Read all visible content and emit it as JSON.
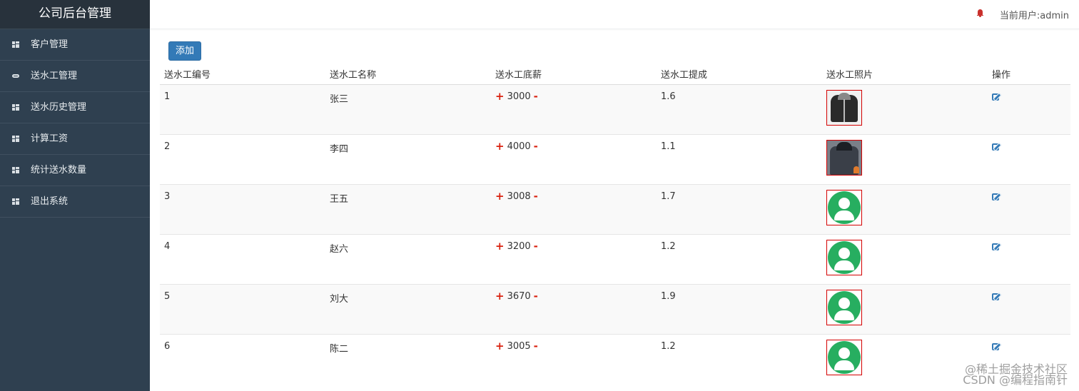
{
  "sidebar": {
    "brand": "公司后台管理",
    "items": [
      {
        "label": "客户管理",
        "icon": "grid-icon"
      },
      {
        "label": "送水工管理",
        "icon": "link-icon"
      },
      {
        "label": "送水历史管理",
        "icon": "grid-icon"
      },
      {
        "label": "计算工资",
        "icon": "grid-icon"
      },
      {
        "label": "统计送水数量",
        "icon": "grid-icon"
      },
      {
        "label": "退出系统",
        "icon": "grid-icon"
      }
    ]
  },
  "header": {
    "current_user": "当前用户:admin",
    "bell_icon": "bell-icon"
  },
  "toolbar": {
    "add_label": "添加"
  },
  "table": {
    "columns": [
      "送水工编号",
      "送水工名称",
      "送水工底薪",
      "送水工提成",
      "送水工照片",
      "操作"
    ],
    "rows": [
      {
        "id": "1",
        "name": "张三",
        "salary": "3000",
        "commission": "1.6",
        "photo": "jacket-photo-1"
      },
      {
        "id": "2",
        "name": "李四",
        "salary": "4000",
        "commission": "1.1",
        "photo": "jacket-photo-2"
      },
      {
        "id": "3",
        "name": "王五",
        "salary": "3008",
        "commission": "1.7",
        "photo": "default-avatar"
      },
      {
        "id": "4",
        "name": "赵六",
        "salary": "3200",
        "commission": "1.2",
        "photo": "default-avatar"
      },
      {
        "id": "5",
        "name": "刘大",
        "salary": "3670",
        "commission": "1.9",
        "photo": "default-avatar"
      },
      {
        "id": "6",
        "name": "陈二",
        "salary": "3005",
        "commission": "1.2",
        "photo": "default-avatar"
      }
    ]
  },
  "colors": {
    "sidebar_bg": "#2f4050",
    "primary": "#337ab7",
    "salary_symbol": "#d9210f",
    "avatar_green": "#27ae60",
    "photo_border": "#d40000"
  },
  "watermark": {
    "line1": "@稀土掘金技术社区",
    "line2": "CSDN @编程指南针"
  }
}
